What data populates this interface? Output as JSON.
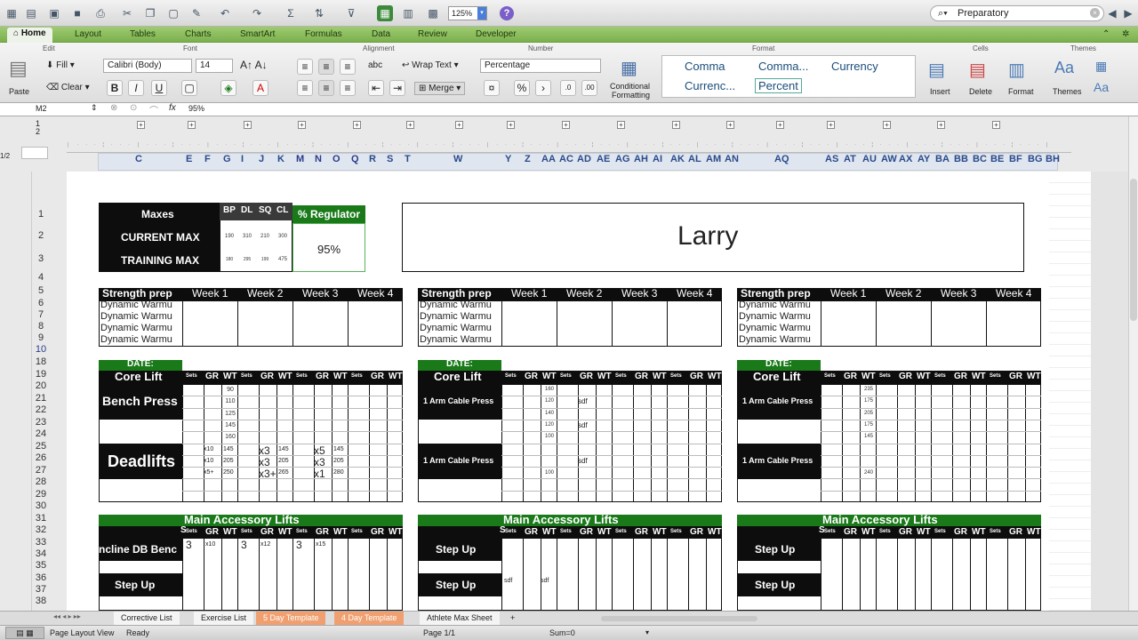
{
  "toolbar": {
    "zoom": "125%",
    "search": "Preparatory",
    "help": "?"
  },
  "ribbon": {
    "tabs": [
      "Home",
      "Layout",
      "Tables",
      "Charts",
      "SmartArt",
      "Formulas",
      "Data",
      "Review",
      "Developer"
    ],
    "groups": [
      "Edit",
      "Font",
      "Alignment",
      "Number",
      "Format",
      "Cells",
      "Themes"
    ],
    "paste": "Paste",
    "fill": "Fill",
    "clear": "Clear",
    "font_name": "Calibri (Body)",
    "font_size": "14",
    "wrap_text": "Wrap Text",
    "merge": "Merge",
    "number_format": "Percentage",
    "abc": "abc",
    "cond_fmt_1": "Conditional",
    "cond_fmt_2": "Formatting",
    "styles": [
      "Comma",
      "Comma...",
      "Currency",
      "Currenc...",
      "Percent"
    ],
    "insert": "Insert",
    "delete": "Delete",
    "format": "Format",
    "themes": "Themes"
  },
  "formula": {
    "cell": "M2",
    "content": "95%",
    "fx": "fx"
  },
  "outline_levels": [
    "1",
    "2",
    "1/2"
  ],
  "columns": [
    "C",
    "E",
    "F",
    "G",
    "I",
    "J",
    "K",
    "M",
    "N",
    "O",
    "Q",
    "R",
    "S",
    "T",
    "W",
    "Y",
    "Z",
    "AA",
    "AC",
    "AD",
    "AE",
    "AG",
    "AH",
    "AI",
    "AK",
    "AL",
    "AM",
    "AN",
    "AQ",
    "AS",
    "AT",
    "AU",
    "AW",
    "AX",
    "AY",
    "BA",
    "BB",
    "BC",
    "BE",
    "BF",
    "BG",
    "BH"
  ],
  "rows": [
    "1",
    "2",
    "3",
    "4",
    "5",
    "6",
    "7",
    "8",
    "9",
    "10",
    "18",
    "19",
    "20",
    "21",
    "22",
    "23",
    "24",
    "25",
    "26",
    "27",
    "28",
    "29",
    "30",
    "31",
    "32",
    "33",
    "34",
    "35",
    "36",
    "37",
    "38"
  ],
  "maxes": {
    "header": "Maxes",
    "lifts": [
      "BP",
      "DL",
      "SQ",
      "CL"
    ],
    "current_label": "CURRENT MAX",
    "current": [
      "190",
      "310",
      "210",
      "300"
    ],
    "training_label": "TRAINING MAX",
    "training": [
      "180",
      "295",
      "199",
      "475"
    ],
    "regulator_label": "% Regulator",
    "regulator_value": "95%"
  },
  "athlete": "Larry",
  "plan": {
    "strength_label": "Strength prep",
    "weeks": [
      "Week 1",
      "Week 2",
      "Week 3",
      "Week 4"
    ],
    "warmup": "Dynamic Warmu",
    "date_label": "DATE:",
    "core_label": "Core Lift",
    "sub_headers": [
      "Sets",
      "GR",
      "WT"
    ],
    "accessory_label": "Main Accessory Lifts",
    "s_marker": "S"
  },
  "block1": {
    "lift1": "Bench Press",
    "lift2": "Deadlifts",
    "wt1": [
      "90",
      "110",
      "125",
      "145",
      "160"
    ],
    "dl": [
      [
        "x10",
        "145",
        "x3",
        "145",
        "x5",
        "145"
      ],
      [
        "x10",
        "205",
        "x3",
        "205",
        "x3",
        "205"
      ],
      [
        "x5+",
        "250",
        "x3+",
        "265",
        "x1",
        "280"
      ]
    ],
    "acc1": "ncline DB Benc",
    "acc1_vals": [
      "3",
      "x10",
      "3",
      "x12",
      "3",
      "x15"
    ],
    "acc2": "Step Up"
  },
  "block2": {
    "lift1": "1 Arm Cable Press",
    "lift2": "1 Arm Cable Press",
    "wt1": [
      "160",
      "120",
      "140",
      "120",
      "100"
    ],
    "sdf": "sdf",
    "wt2": "100",
    "acc1": "Step Up",
    "acc2": "Step Up"
  },
  "block3": {
    "lift1": "1 Arm Cable Press",
    "lift2": "1 Arm Cable Press",
    "wt1": [
      "235",
      "175",
      "205",
      "175",
      "145"
    ],
    "wt2": "240",
    "acc1": "Step Up",
    "acc2": "Step Up"
  },
  "sheet_tabs": [
    "Corrective List",
    "Exercise List",
    "5 Day Template",
    "4 Day Template",
    "Athlete Max Sheet",
    "+"
  ],
  "status": {
    "view": "Page Layout View",
    "ready": "Ready",
    "page": "Page 1/1",
    "sum": "Sum=0"
  }
}
